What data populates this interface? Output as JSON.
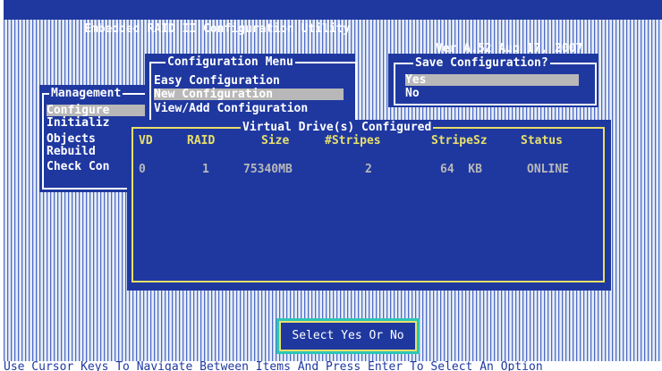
{
  "titlebar": {
    "title": "Embedded RAID II Configuration Utility",
    "version": "Ver A.52 Aug 17, 2007"
  },
  "management_menu": {
    "title": "Management",
    "items": [
      "Configure",
      "Initializ",
      "Objects",
      "Rebuild",
      "Check Con"
    ],
    "selected": "Configure"
  },
  "config_menu": {
    "title": "Configuration Menu",
    "items": [
      "Easy Configuration",
      "New Configuration",
      "View/Add Configuration"
    ],
    "selected": "New Configuration"
  },
  "save_dialog": {
    "title": "Save Configuration?",
    "options": [
      "Yes",
      "No"
    ],
    "selected": "Yes"
  },
  "vd_table": {
    "title": "Virtual Drive(s) Configured",
    "columns": [
      "VD",
      "RAID",
      "Size",
      "#Stripes",
      "StripeSz",
      "Status"
    ],
    "rows": [
      {
        "vd": "0",
        "raid": "1",
        "size": "75340MB",
        "stripes": "2",
        "stripesz": "64  KB",
        "status": "ONLINE"
      }
    ]
  },
  "prompt": "Select Yes Or No",
  "statusbar": "Use Cursor Keys To Navigate Between Items And Press Enter To Select An Option",
  "colors": {
    "panel": "#1f38a0",
    "highlight": "#b8b8b8",
    "border_yellow": "#e8e06a",
    "prompt_bg": "#2cc6b8"
  }
}
